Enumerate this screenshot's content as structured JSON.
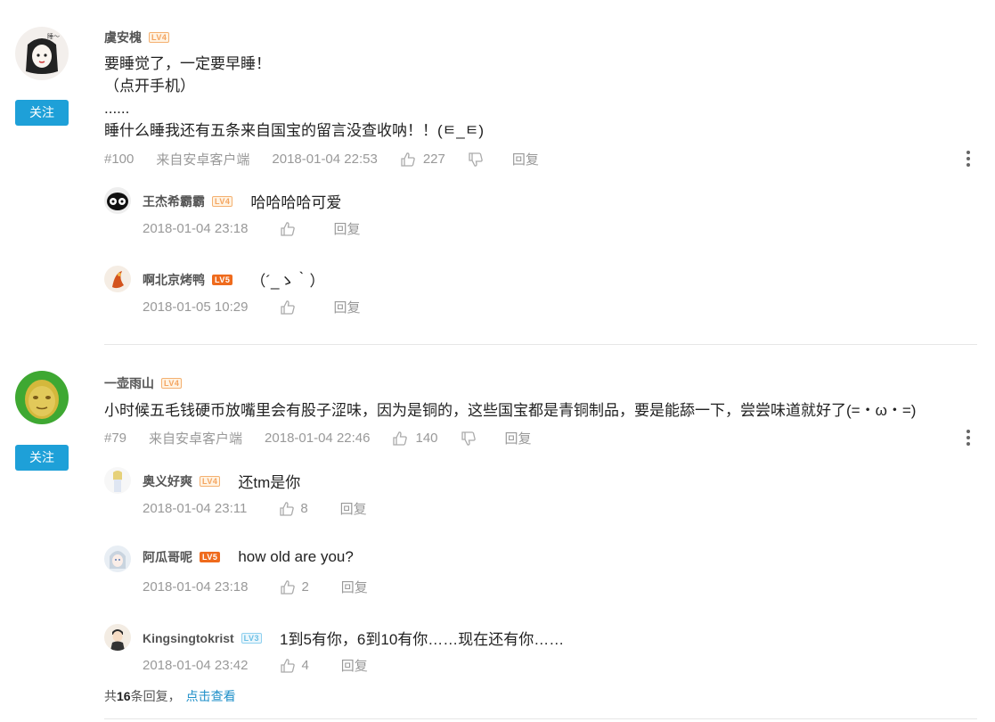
{
  "comments": [
    {
      "author": "虞安槐",
      "level": "LV4",
      "follow_label": "关注",
      "text": "要睡觉了，一定要早睡！\n（点开手机）\n......\n睡什么睡我还有五条来自国宝的留言没查收呐！！(ㅌ_ㅌ)",
      "floor": "#100",
      "source": "来自安卓客户端",
      "time": "2018-01-04 22:53",
      "likes": "227",
      "reply_label": "回复",
      "replies": [
        {
          "author": "王杰希霸霸",
          "level": "LV4",
          "text": "哈哈哈哈可爱",
          "time": "2018-01-04 23:18",
          "likes": "",
          "reply_label": "回复"
        },
        {
          "author": "啊北京烤鸭",
          "level": "LV5",
          "text": "（´_ゝ｀）",
          "time": "2018-01-05 10:29",
          "likes": "",
          "reply_label": "回复"
        }
      ]
    },
    {
      "author": "一壶雨山",
      "level": "LV4",
      "follow_label": "关注",
      "text": "小时候五毛钱硬币放嘴里会有股子涩味，因为是铜的，这些国宝都是青铜制品，要是能舔一下，尝尝味道就好了(=・ω・=)",
      "floor": "#79",
      "source": "来自安卓客户端",
      "time": "2018-01-04 22:46",
      "likes": "140",
      "reply_label": "回复",
      "replies": [
        {
          "author": "奥义好爽",
          "level": "LV4",
          "text": "还tm是你",
          "time": "2018-01-04 23:11",
          "likes": "8",
          "reply_label": "回复"
        },
        {
          "author": "阿瓜哥呢",
          "level": "LV5",
          "text": "how old are you?",
          "time": "2018-01-04 23:18",
          "likes": "2",
          "reply_label": "回复"
        },
        {
          "author": "Kingsingtokrist",
          "level": "LV3",
          "text": "1到5有你，6到10有你……现在还有你……",
          "time": "2018-01-04 23:42",
          "likes": "4",
          "reply_label": "回复"
        }
      ],
      "summary_prefix": "共",
      "summary_count": "16",
      "summary_suffix": "条回复，",
      "summary_link": "点击查看"
    }
  ],
  "colors": {
    "follow_button": "#1ea0d8",
    "link": "#1e8fc8",
    "lv5": "#ef6b1d",
    "lv4": "#f4a460",
    "lv3": "#6cc0e6"
  },
  "icons": [
    "thumb-up-icon",
    "thumb-down-icon",
    "more-vertical-icon"
  ]
}
